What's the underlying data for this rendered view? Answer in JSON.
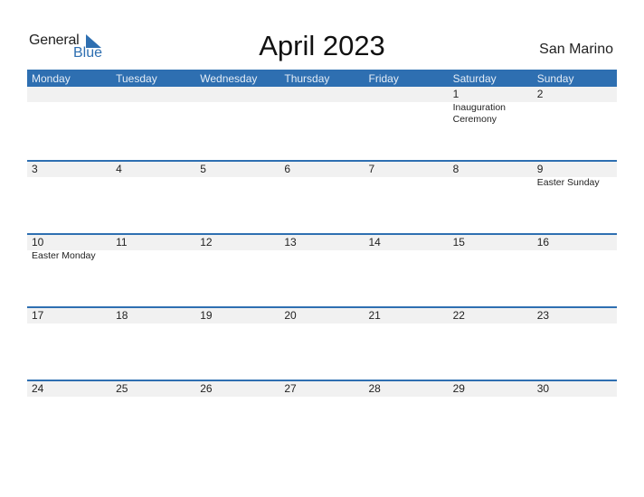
{
  "logo": {
    "text_general": "General",
    "text_blue": "Blue",
    "icon": "triangle-flag-icon"
  },
  "title": "April 2023",
  "country": "San Marino",
  "colors": {
    "accent": "#2e6fb1",
    "date_strip": "#f1f1f1"
  },
  "weekdays": [
    "Monday",
    "Tuesday",
    "Wednesday",
    "Thursday",
    "Friday",
    "Saturday",
    "Sunday"
  ],
  "weeks": [
    [
      {
        "day": "",
        "event": ""
      },
      {
        "day": "",
        "event": ""
      },
      {
        "day": "",
        "event": ""
      },
      {
        "day": "",
        "event": ""
      },
      {
        "day": "",
        "event": ""
      },
      {
        "day": "1",
        "event": "Inauguration Ceremony"
      },
      {
        "day": "2",
        "event": ""
      }
    ],
    [
      {
        "day": "3",
        "event": ""
      },
      {
        "day": "4",
        "event": ""
      },
      {
        "day": "5",
        "event": ""
      },
      {
        "day": "6",
        "event": ""
      },
      {
        "day": "7",
        "event": ""
      },
      {
        "day": "8",
        "event": ""
      },
      {
        "day": "9",
        "event": "Easter Sunday"
      }
    ],
    [
      {
        "day": "10",
        "event": "Easter Monday"
      },
      {
        "day": "11",
        "event": ""
      },
      {
        "day": "12",
        "event": ""
      },
      {
        "day": "13",
        "event": ""
      },
      {
        "day": "14",
        "event": ""
      },
      {
        "day": "15",
        "event": ""
      },
      {
        "day": "16",
        "event": ""
      }
    ],
    [
      {
        "day": "17",
        "event": ""
      },
      {
        "day": "18",
        "event": ""
      },
      {
        "day": "19",
        "event": ""
      },
      {
        "day": "20",
        "event": ""
      },
      {
        "day": "21",
        "event": ""
      },
      {
        "day": "22",
        "event": ""
      },
      {
        "day": "23",
        "event": ""
      }
    ],
    [
      {
        "day": "24",
        "event": ""
      },
      {
        "day": "25",
        "event": ""
      },
      {
        "day": "26",
        "event": ""
      },
      {
        "day": "27",
        "event": ""
      },
      {
        "day": "28",
        "event": ""
      },
      {
        "day": "29",
        "event": ""
      },
      {
        "day": "30",
        "event": ""
      }
    ]
  ]
}
